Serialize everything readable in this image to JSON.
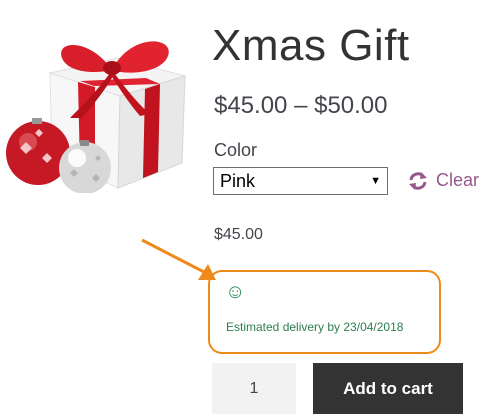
{
  "product": {
    "title": "Xmas Gift",
    "price_range": "$45.00 – $50.00",
    "image_icon": "gift-box-with-ornaments"
  },
  "variation": {
    "color_label": "Color",
    "selected_color": "Pink",
    "clear_label": "Clear",
    "clear_icon": "refresh-icon",
    "price": "$45.00"
  },
  "delivery": {
    "icon": "smiley-icon",
    "smiley_glyph": "☺",
    "message": "Estimated delivery by 23/04/2018",
    "highlight_color": "#ee8a1c",
    "text_color": "#2e7d4e"
  },
  "cart": {
    "quantity": "1",
    "add_button_label": "Add to cart"
  },
  "colors": {
    "accent": "#96588a",
    "button_bg": "#333333"
  }
}
